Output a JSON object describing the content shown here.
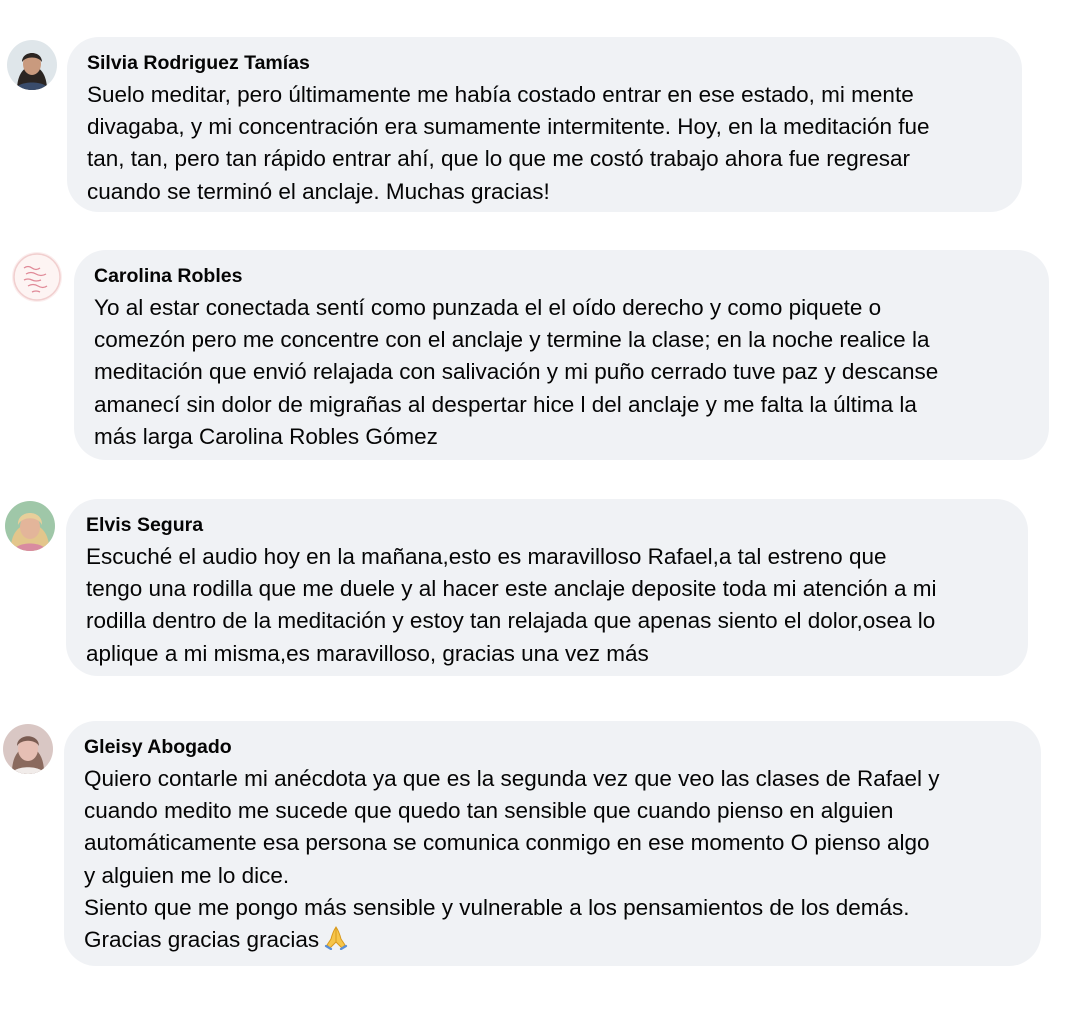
{
  "comments": [
    {
      "author": "Silvia Rodriguez Tamías",
      "avatar": "woman-portrait-avatar",
      "lines": [
        "Suelo meditar, pero últimamente me había costado entrar en ese estado, mi mente",
        "divagaba, y mi concentración era sumamente intermitente. Hoy, en la meditación fue",
        "tan, tan, pero tan rápido entrar ahí, que lo que me costó trabajo ahora fue regresar",
        "cuando se terminó el anclaje. Muchas gracias!"
      ]
    },
    {
      "author": "Carolina Robles",
      "avatar": "handwritten-note-avatar",
      "lines": [
        "Yo al estar conectada sentí como punzada el el oído derecho y como piquete o",
        "comezón pero me concentre con el anclaje y termine la clase; en la noche realice la",
        "meditación que envió relajada con salivación y mi puño cerrado tuve paz y descanse",
        "amanecí sin dolor de migrañas al despertar hice l del anclaje y me falta la última la",
        "más larga Carolina Robles Gómez"
      ]
    },
    {
      "author": "Elvis Segura",
      "avatar": "woman-blonde-portrait-avatar",
      "lines": [
        "Escuché el audio hoy en la mañana,esto es maravilloso Rafael,a tal estreno que",
        "tengo una rodilla que me duele y al hacer este anclaje deposite toda mi atención a mi",
        "rodilla dentro de la meditación y estoy tan relajada que apenas siento el dolor,osea lo",
        "aplique a mi misma,es maravilloso, gracias una vez más"
      ]
    },
    {
      "author": "Gleisy Abogado",
      "avatar": "woman-portrait-avatar",
      "lines": [
        "Quiero contarle mi anécdota ya que es la segunda vez que veo las clases de Rafael y",
        "cuando medito me sucede que quedo tan sensible que cuando pienso en alguien",
        "automáticamente esa persona se comunica conmigo en ese momento O pienso algo",
        "y alguien me lo dice.",
        "Siento que me pongo más sensible y vulnerable a los pensamientos de los demás.",
        "Gracias gracias gracias"
      ],
      "trailing_emoji": "folded-hands-icon"
    }
  ]
}
